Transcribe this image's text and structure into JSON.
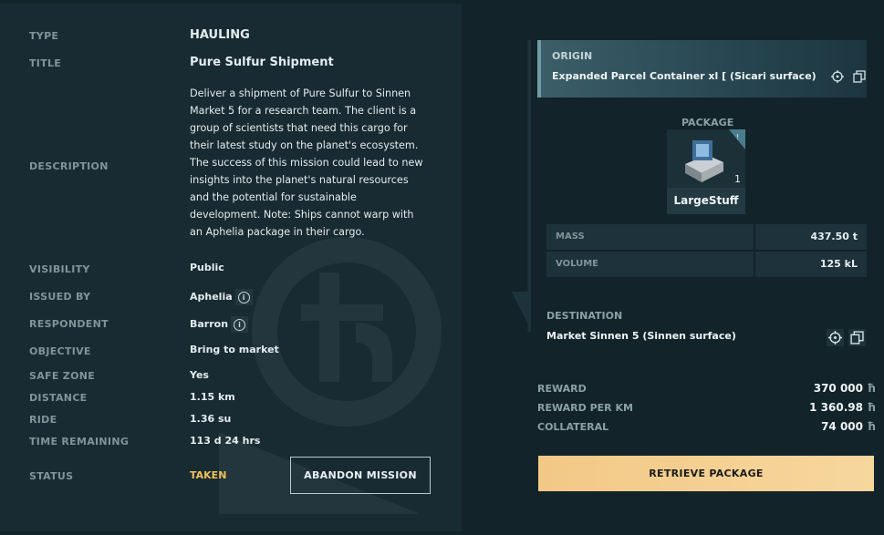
{
  "details": {
    "type_label": "TYPE",
    "type_value": "HAULING",
    "title_label": "TITLE",
    "title_value": "Pure Sulfur Shipment",
    "description_label": "DESCRIPTION",
    "description_value": "Deliver a shipment of Pure Sulfur to Sinnen Market 5 for a research team. The client is a group of scientists that need this cargo for their latest study on the planet's ecosystem. The success of this mission could lead to new insights into the planet's natural resources and the potential for sustainable development. Note: Ships cannot warp with an Aphelia package in their cargo.",
    "visibility_label": "VISIBILITY",
    "visibility_value": "Public",
    "issued_by_label": "ISSUED BY",
    "issued_by_value": "Aphelia",
    "respondent_label": "RESPONDENT",
    "respondent_value": "Barron",
    "objective_label": "OBJECTIVE",
    "objective_value": "Bring to market",
    "safe_zone_label": "SAFE ZONE",
    "safe_zone_value": "Yes",
    "distance_label": "DISTANCE",
    "distance_value": "1.15 km",
    "ride_label": "RIDE",
    "ride_value": "1.36 su",
    "time_remaining_label": "TIME REMAINING",
    "time_remaining_value": "113 d 24 hrs",
    "status_label": "STATUS",
    "status_value": "TAKEN",
    "abandon_label": "ABANDON MISSION"
  },
  "route": {
    "origin_label": "ORIGIN",
    "origin_value": "Expanded Parcel Container xl [ (Sicari surface)",
    "package_label": "PACKAGE",
    "package_name": "LargeStuff",
    "package_count": "1",
    "mass_label": "MASS",
    "mass_value": "437.50 t",
    "volume_label": "VOLUME",
    "volume_value": "125 kL",
    "destination_label": "DESTINATION",
    "destination_value": "Market Sinnen 5 (Sinnen surface)"
  },
  "rewards": {
    "reward_label": "REWARD",
    "reward_value": "370 000",
    "reward_per_km_label": "REWARD PER KM",
    "reward_per_km_value": "1 360.98",
    "collateral_label": "COLLATERAL",
    "collateral_value": "74 000",
    "currency_symbol": "ħ",
    "retrieve_label": "RETRIEVE PACKAGE"
  },
  "icons": {
    "info": "info-icon",
    "locate": "crosshair-icon",
    "copy": "copy-icon"
  },
  "colors": {
    "status_taken": "#f1c15a",
    "retrieve_button": "#f3c886",
    "panel_bg": "#192b32",
    "page_bg": "#13232a"
  }
}
